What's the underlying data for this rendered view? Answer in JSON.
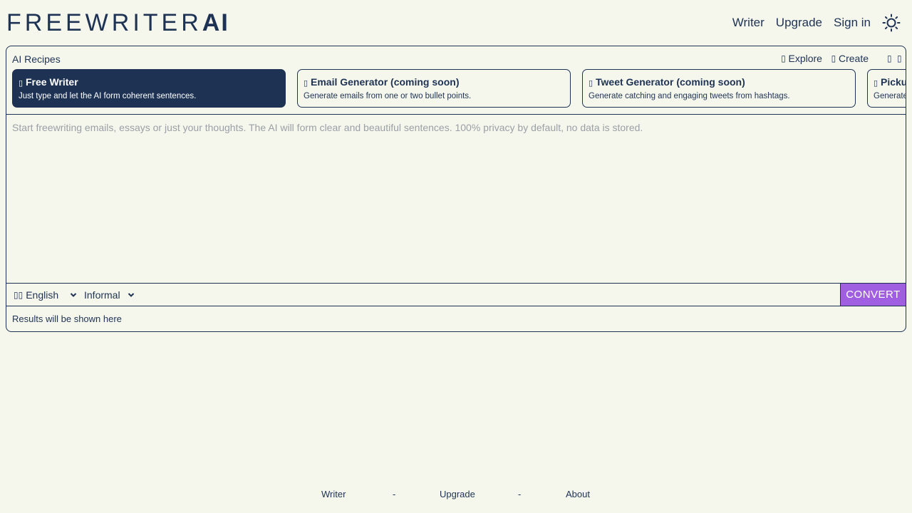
{
  "header": {
    "logo_main": "FREEWRITER",
    "logo_accent": "AI",
    "nav": [
      "Writer",
      "Upgrade",
      "Sign in"
    ],
    "theme_icon": "sun-icon"
  },
  "recipes": {
    "title": "AI Recipes",
    "explore_label": "Explore",
    "create_label": "Create",
    "items": [
      {
        "title": "Free Writer",
        "desc": "Just type and let the AI form coherent sentences."
      },
      {
        "title": "Email Generator (coming soon)",
        "desc": "Generate emails from one or two bullet points."
      },
      {
        "title": "Tweet Generator (coming soon)",
        "desc": "Generate catching and engaging tweets from hashtags."
      },
      {
        "title": "Pickup",
        "desc": "Generate"
      }
    ]
  },
  "editor": {
    "placeholder": "Start freewriting emails, essays or just your thoughts. The AI will form clear and beautiful sentences. 100% privacy by default, no data is stored.",
    "value": ""
  },
  "toolbar": {
    "language": "English",
    "tone": "Informal",
    "convert_label": "CONVERT"
  },
  "results": {
    "text": "Results will be shown here"
  },
  "footer": {
    "links": [
      "Writer",
      "Upgrade",
      "About"
    ],
    "separator": "-"
  },
  "colors": {
    "background": "#f5f6ec",
    "primary": "#1e3354",
    "accent": "#a05ee0"
  }
}
